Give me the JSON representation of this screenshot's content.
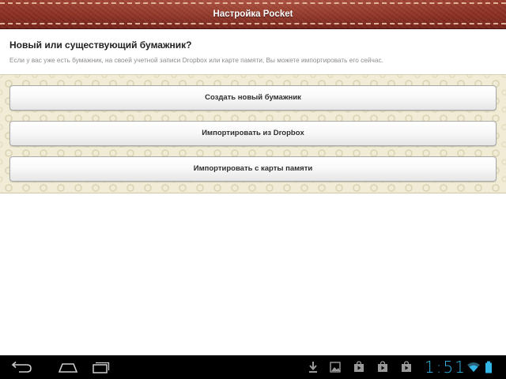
{
  "titlebar": {
    "title": "Настройка Pocket"
  },
  "header": {
    "heading": "Новый или существующий бумажник?",
    "description": "Если у вас уже есть бумажник, на своей учетной записи Dropbox или карте памяти, Вы можете импортировать его сейчас."
  },
  "actions": [
    {
      "label": "Создать новый бумажник"
    },
    {
      "label": "Импортировать из Dropbox"
    },
    {
      "label": "Импортировать с карты памяти"
    }
  ],
  "navbar": {
    "buttons": [
      "back-icon",
      "home-icon",
      "recent-apps-icon"
    ],
    "notifications": [
      "download-icon",
      "image-icon",
      "play-store-icon",
      "play-store-icon",
      "play-store-icon"
    ],
    "clock": "1:51",
    "status": [
      "wifi-icon",
      "battery-icon"
    ],
    "accent_color": "#33b5e5"
  },
  "theme": {
    "titlebar_color": "#8a2c1f",
    "panel_color": "#f1ecd5"
  }
}
